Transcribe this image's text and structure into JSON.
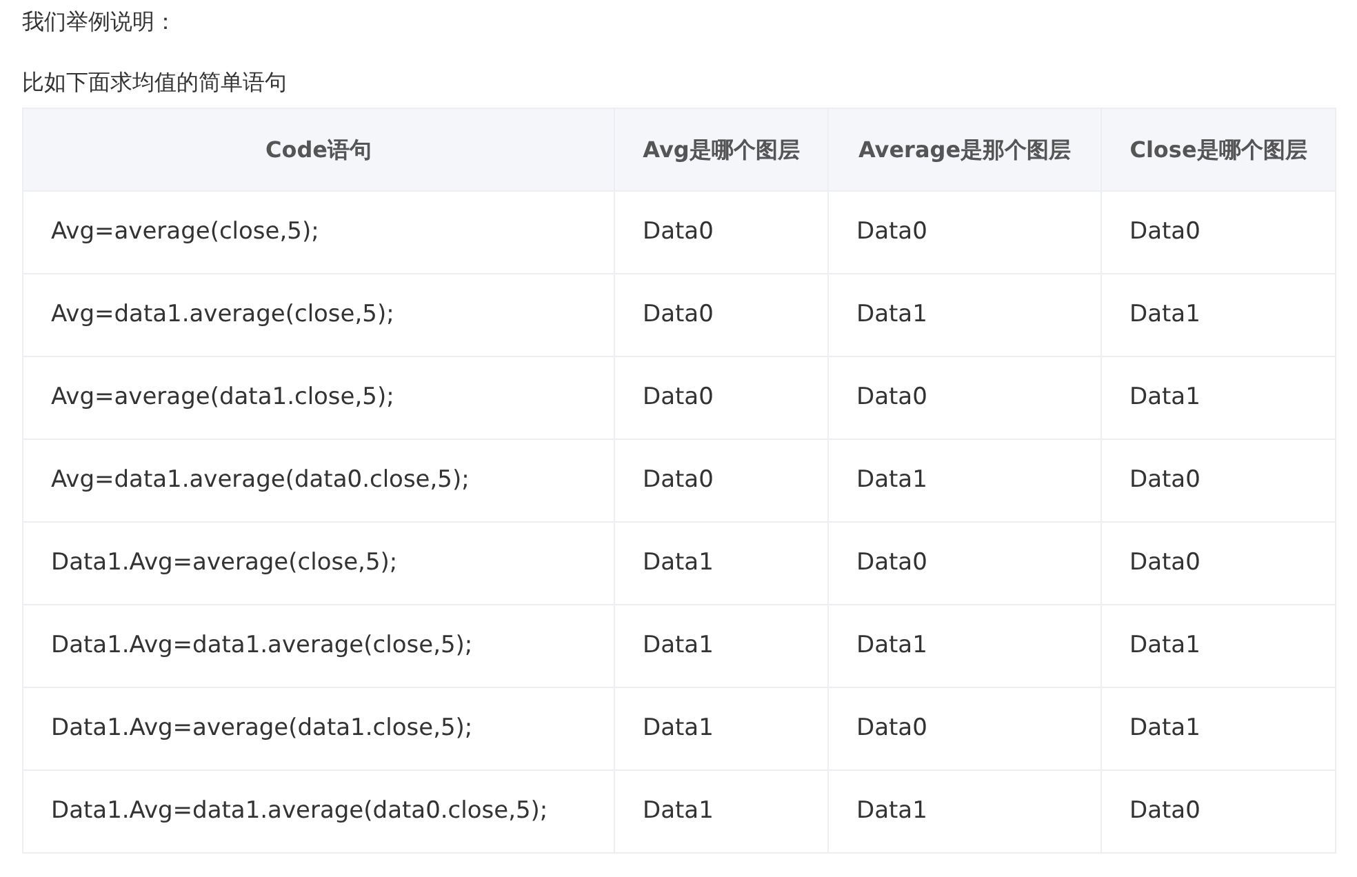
{
  "paragraphs": [
    "我们举例说明：",
    "比如下面求均值的简单语句"
  ],
  "table": {
    "columns": [
      "Code语句",
      "Avg是哪个图层",
      "Average是那个图层",
      "Close是哪个图层"
    ],
    "rows": [
      [
        "Avg=average(close,5);",
        "Data0",
        "Data0",
        "Data0"
      ],
      [
        "Avg=data1.average(close,5);",
        "Data0",
        "Data1",
        "Data1"
      ],
      [
        "Avg=average(data1.close,5);",
        "Data0",
        "Data0",
        "Data1"
      ],
      [
        "Avg=data1.average(data0.close,5);",
        "Data0",
        "Data1",
        "Data0"
      ],
      [
        "Data1.Avg=average(close,5);",
        "Data1",
        "Data0",
        "Data0"
      ],
      [
        "Data1.Avg=data1.average(close,5);",
        "Data1",
        "Data1",
        "Data1"
      ],
      [
        "Data1.Avg=average(data1.close,5);",
        "Data1",
        "Data0",
        "Data1"
      ],
      [
        "Data1.Avg=data1.average(data0.close,5);",
        "Data1",
        "Data1",
        "Data0"
      ]
    ]
  }
}
